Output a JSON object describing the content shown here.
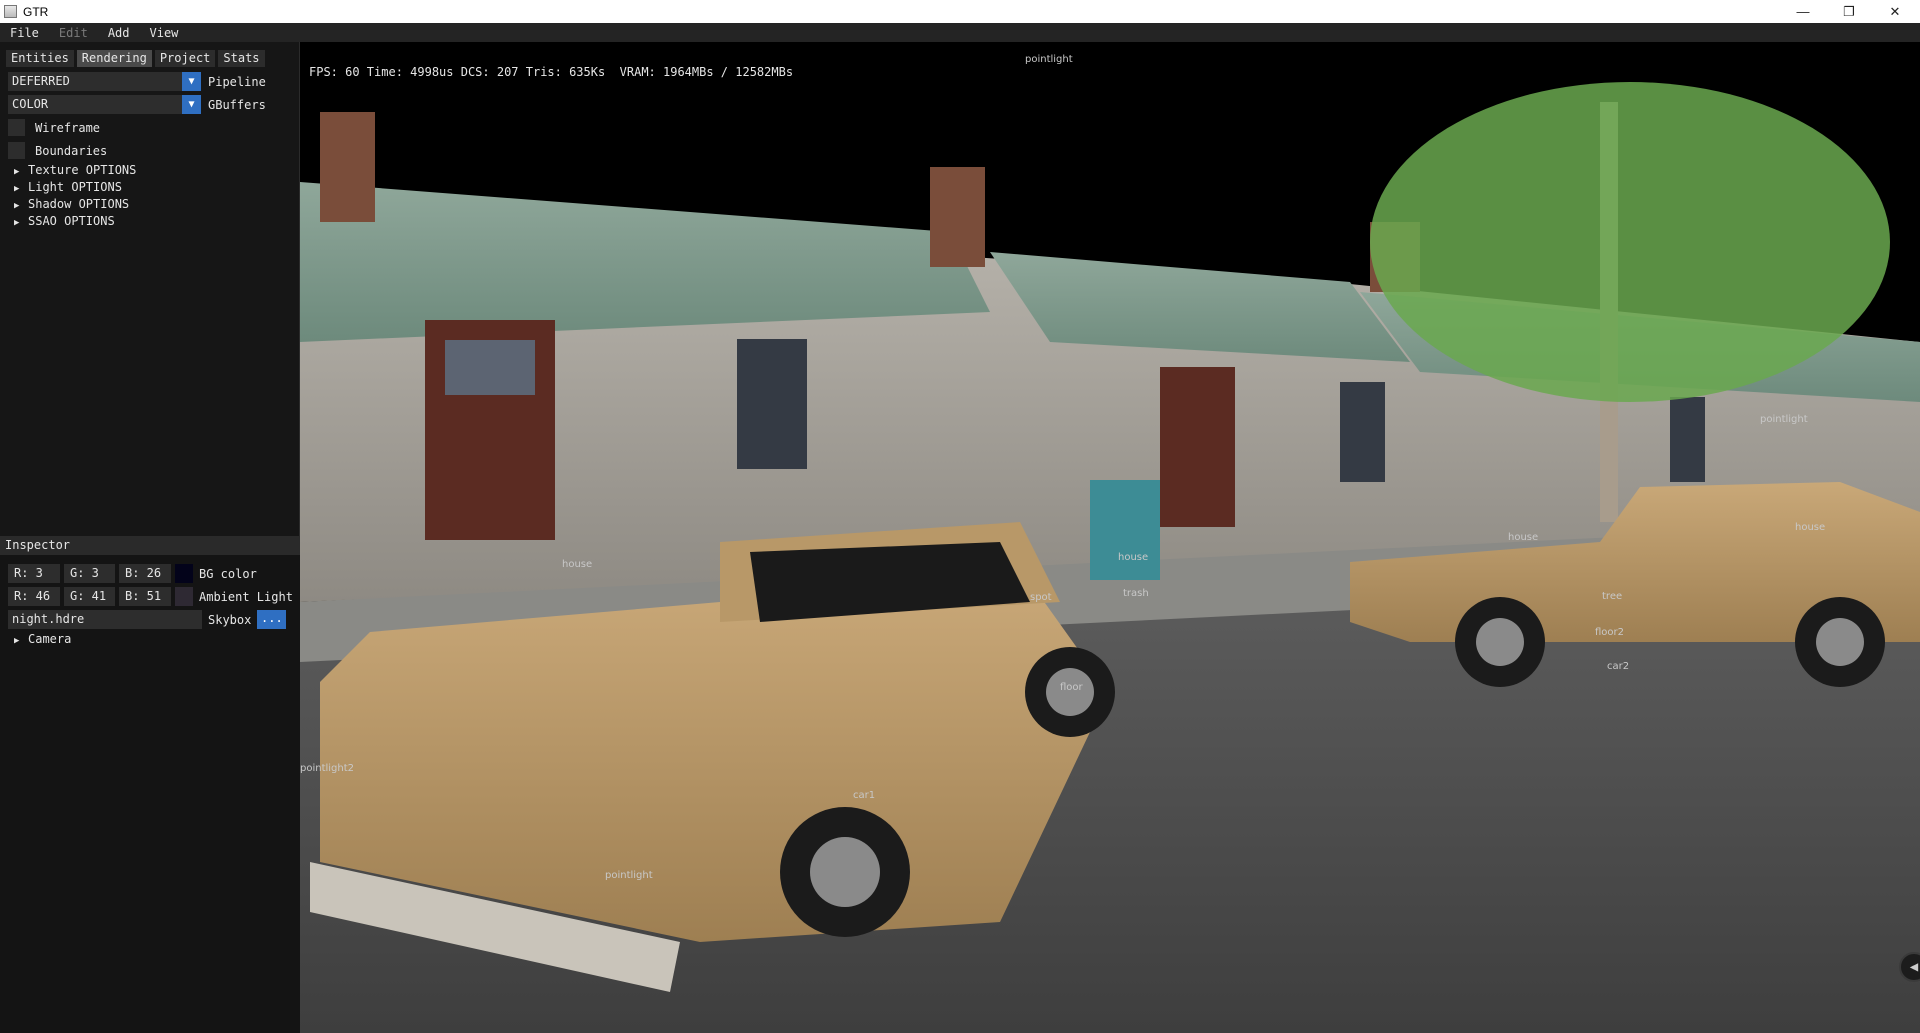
{
  "window": {
    "title": "GTR",
    "minimize": "—",
    "maximize": "❐",
    "close": "✕"
  },
  "menu": {
    "file": "File",
    "edit": "Edit",
    "add": "Add",
    "view": "View"
  },
  "tabs": [
    "Entities",
    "Rendering",
    "Project",
    "Stats"
  ],
  "rendering": {
    "pipeline_value": "DEFERRED",
    "pipeline_label": "Pipeline",
    "gbuffers_value": "COLOR",
    "gbuffers_label": "GBuffers",
    "wireframe_label": "Wireframe",
    "boundaries_label": "Boundaries",
    "options": [
      "Texture OPTIONS",
      "Light OPTIONS",
      "Shadow OPTIONS",
      "SSAO OPTIONS"
    ]
  },
  "inspector": {
    "title": "Inspector",
    "bg_color": {
      "r": "R:  3",
      "g": "G:  3",
      "b": "B: 26",
      "label": "BG color",
      "swatch": "#03031a"
    },
    "ambient": {
      "r": "R: 46",
      "g": "G: 41",
      "b": "B: 51",
      "label": "Ambient Light",
      "swatch": "#2e2933"
    },
    "skybox_value": "night.hdre",
    "skybox_label": "Skybox",
    "skybox_button": "...",
    "camera_label": "Camera"
  },
  "viewport": {
    "stats": "FPS: 60 Time: 4998us DCS: 207 Tris: 635Ks  VRAM: 1964MBs / 12582MBs",
    "labels": [
      "pointlight",
      "house",
      "house",
      "house",
      "house",
      "trash",
      "spot",
      "floor",
      "floor2",
      "car1",
      "car2",
      "pointlight2",
      "pointlight",
      "pointlight",
      "tree"
    ],
    "nav_icon": "◀"
  },
  "colors": {
    "accent": "#2f6fc2",
    "panel": "#141414",
    "menubar": "#242424"
  }
}
